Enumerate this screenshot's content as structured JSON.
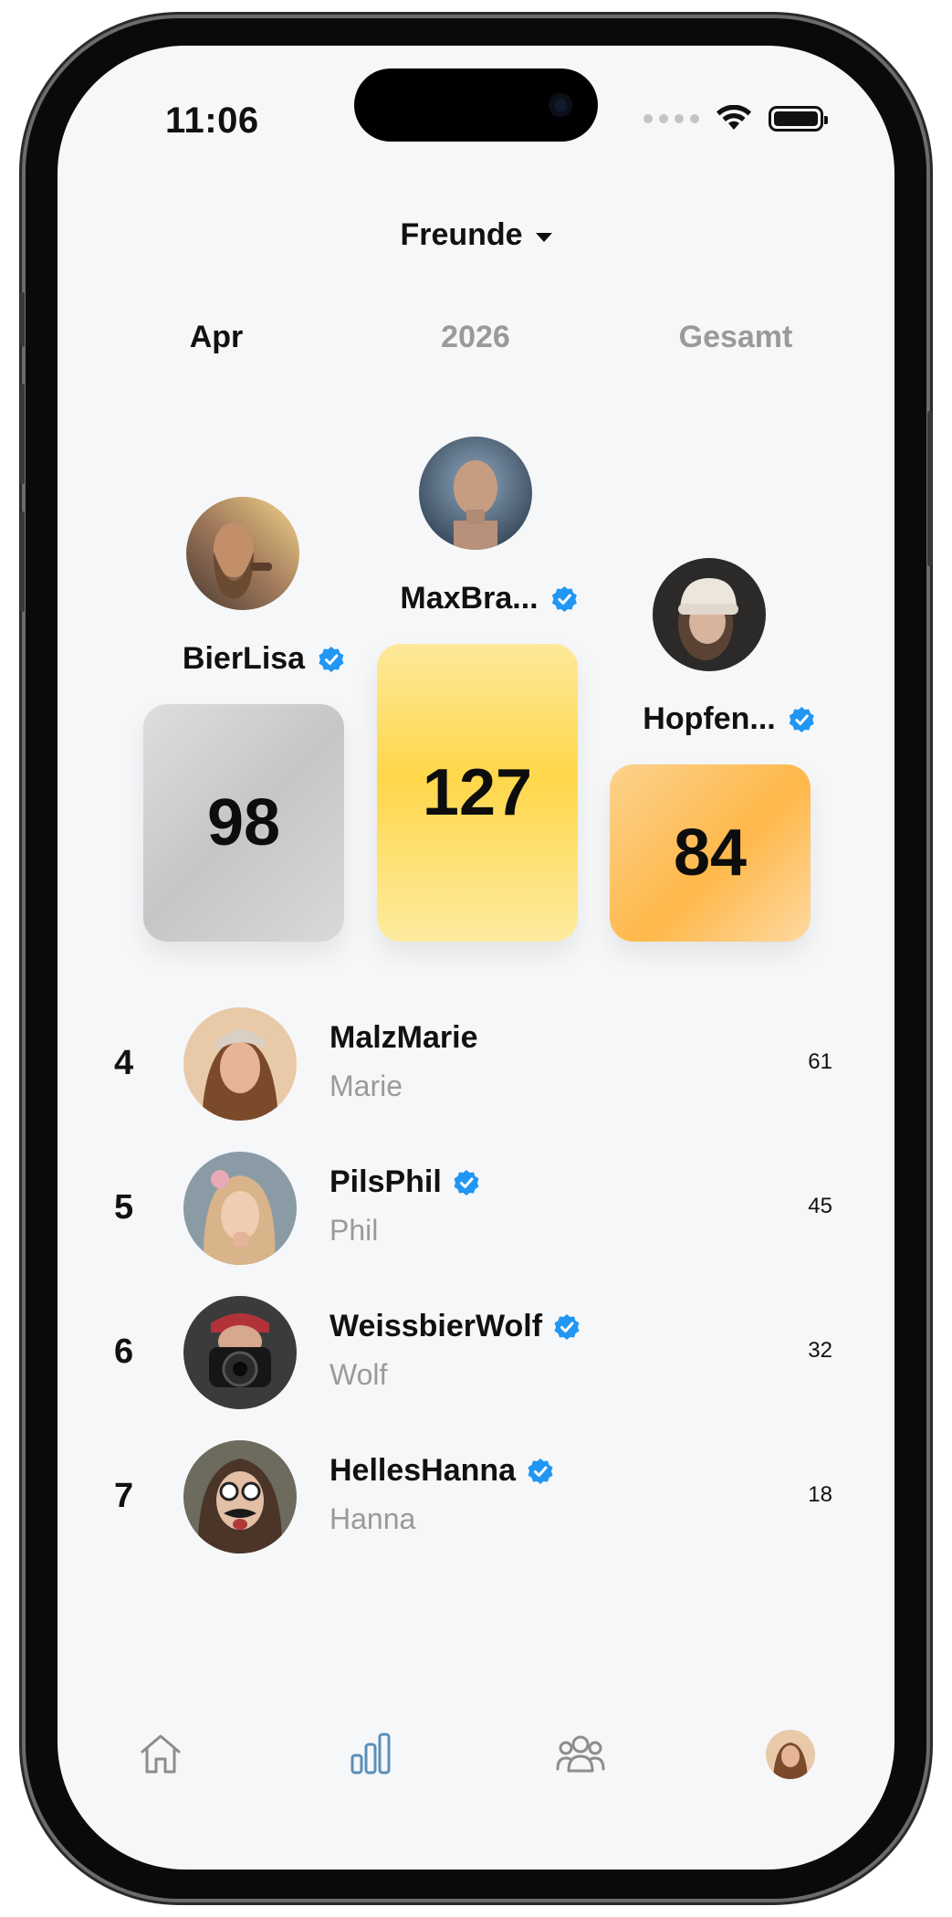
{
  "status_bar": {
    "time": "11:06"
  },
  "group_selector": {
    "label": "Freunde"
  },
  "period_tabs": [
    {
      "label": "Apr",
      "active": true
    },
    {
      "label": "2026",
      "active": false
    },
    {
      "label": "Gesamt",
      "active": false
    }
  ],
  "podium": {
    "first": {
      "username": "MaxBra...",
      "score": "127",
      "verified": true
    },
    "second": {
      "username": "BierLisa",
      "score": "98",
      "verified": true
    },
    "third": {
      "username": "Hopfen...",
      "score": "84",
      "verified": true
    }
  },
  "leaderboard": [
    {
      "rank": "4",
      "username": "MalzMarie",
      "name": "Marie",
      "score": "61",
      "verified": false
    },
    {
      "rank": "5",
      "username": "PilsPhil",
      "name": "Phil",
      "score": "45",
      "verified": true
    },
    {
      "rank": "6",
      "username": "WeissbierWolf",
      "name": "Wolf",
      "score": "32",
      "verified": true
    },
    {
      "rank": "7",
      "username": "HellesHanna",
      "name": "Hanna",
      "score": "18",
      "verified": true
    }
  ],
  "tab_bar": {
    "items": [
      {
        "icon": "home-icon",
        "active": false
      },
      {
        "icon": "leaderboard-icon",
        "active": true
      },
      {
        "icon": "friends-icon",
        "active": false
      },
      {
        "icon": "profile-avatar",
        "active": false
      }
    ]
  },
  "colors": {
    "verified": "#2196f3",
    "active_tab_icon": "#5b8fb9",
    "inactive_icon": "#8d8d8d",
    "muted_text": "#9a9a9a"
  }
}
